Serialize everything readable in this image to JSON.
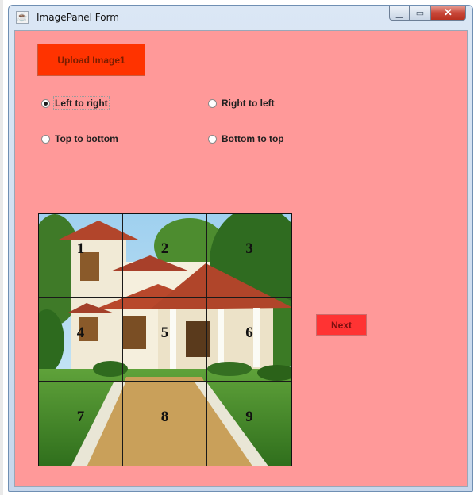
{
  "window": {
    "title": "ImagePanel Form",
    "icon": "java-cup-icon",
    "controls": [
      "minimize-icon",
      "maximize-icon",
      "close-icon"
    ],
    "background_color": "#ff9999"
  },
  "upload_button": {
    "label": "Upload Image1",
    "color": "#ff3300"
  },
  "direction_options": [
    {
      "label": "Left to right",
      "selected": true
    },
    {
      "label": "Right to left",
      "selected": false
    },
    {
      "label": "Top to bottom",
      "selected": false
    },
    {
      "label": "Bottom to top",
      "selected": false
    }
  ],
  "image_panel": {
    "image": "house-photo",
    "grid": "3x3",
    "tiles": [
      "1",
      "2",
      "3",
      "4",
      "5",
      "6",
      "7",
      "8",
      "9"
    ]
  },
  "next_button": {
    "label": "Next",
    "color": "#ff3333"
  }
}
